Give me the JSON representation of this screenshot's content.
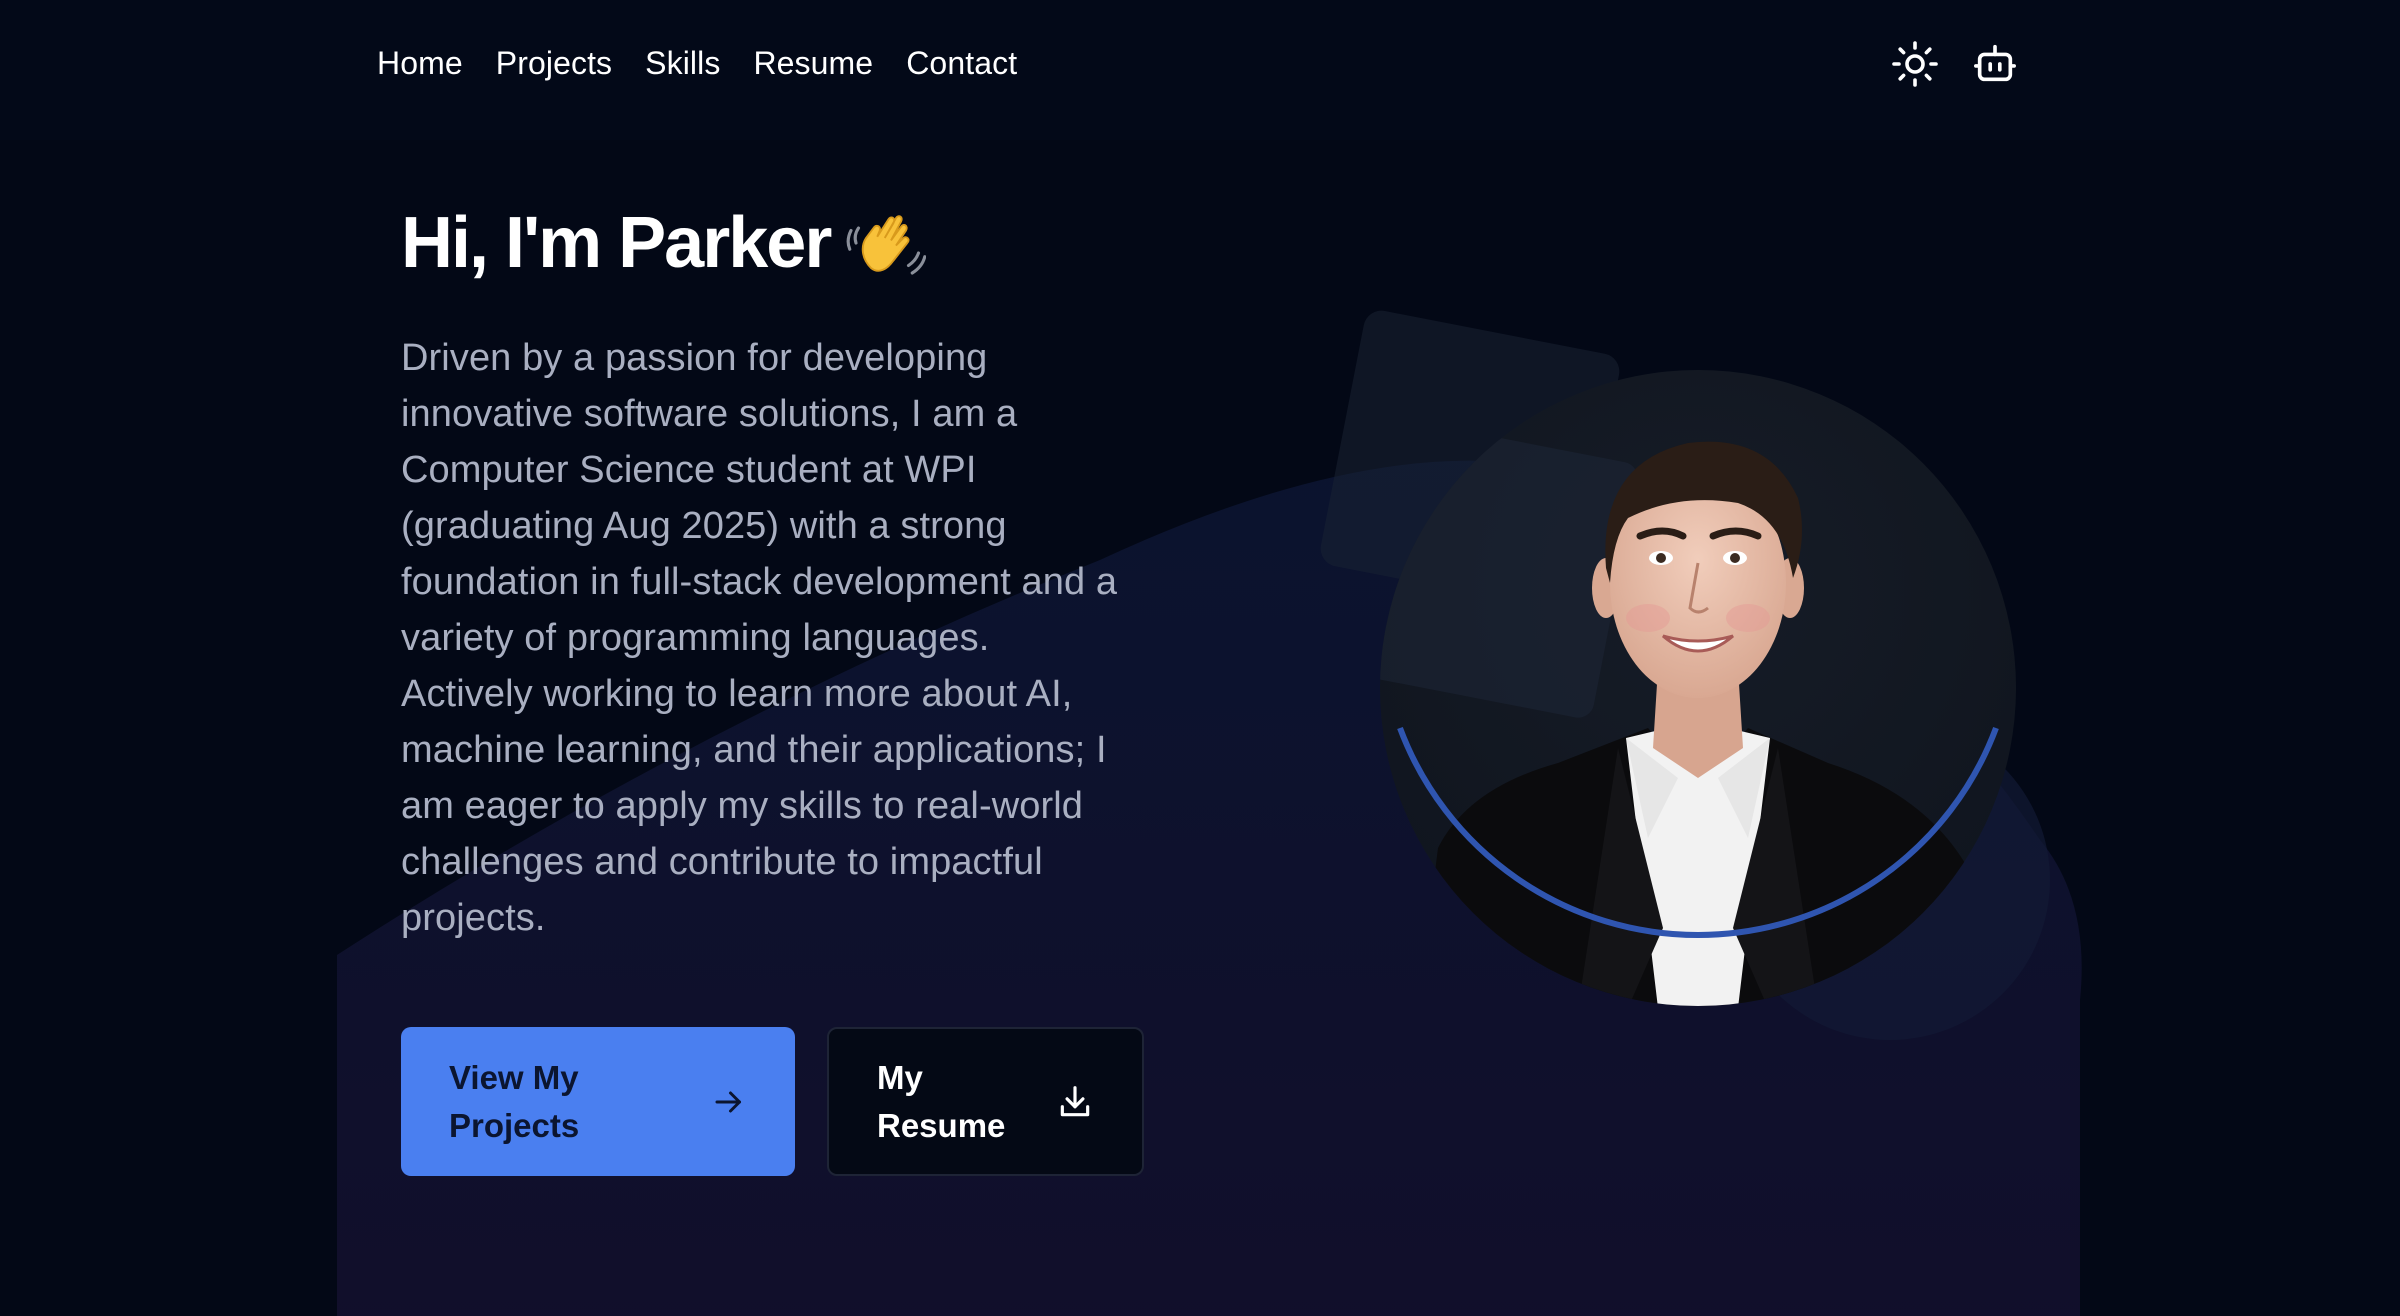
{
  "nav": {
    "links": [
      {
        "label": "Home"
      },
      {
        "label": "Projects"
      },
      {
        "label": "Skills"
      },
      {
        "label": "Resume"
      },
      {
        "label": "Contact"
      }
    ],
    "icons": {
      "theme_toggle": "sun-icon",
      "chatbot": "robot-icon"
    }
  },
  "hero": {
    "title": "Hi, I'm Parker",
    "title_emoji": "waving-hand-icon",
    "description": "Driven by a passion for developing innovative software solutions, I am a Computer Science student at WPI (graduating Aug 2025) with a strong foundation in full-stack development and a variety of programming languages. Actively working to learn more about AI, machine learning, and their applications; I am eager to apply my skills to real-world challenges and contribute to impactful projects.",
    "primary_button": {
      "label": "View My Projects",
      "icon": "arrow-right-icon"
    },
    "secondary_button": {
      "label": "My Resume",
      "icon": "download-icon"
    }
  },
  "colors": {
    "background": "#030816",
    "accent": "#4a7ff0",
    "text_muted": "#a9afc1"
  }
}
